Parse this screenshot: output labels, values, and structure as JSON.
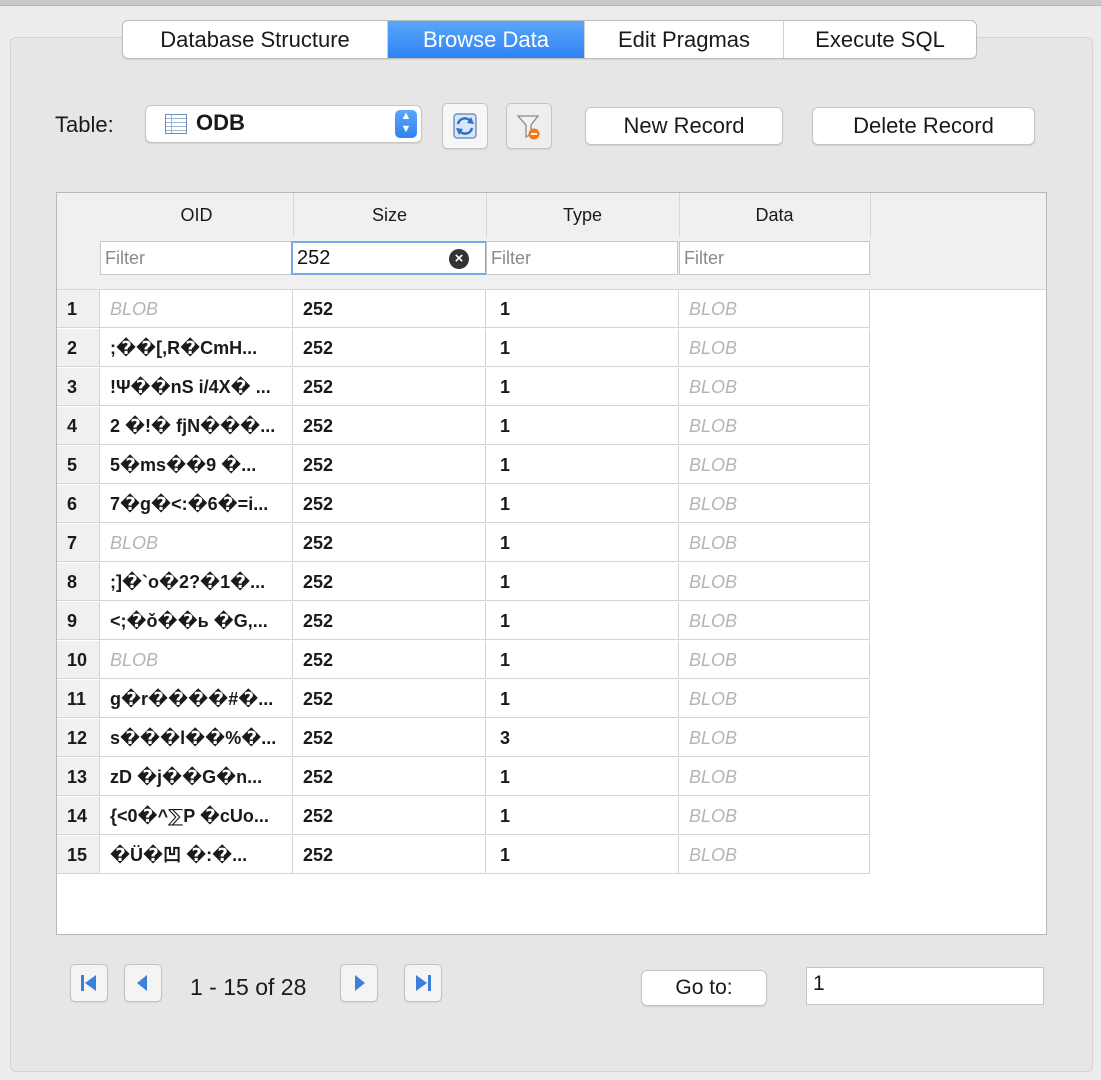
{
  "tabs": [
    {
      "label": "Database Structure",
      "active": false
    },
    {
      "label": "Browse Data",
      "active": true
    },
    {
      "label": "Edit Pragmas",
      "active": false
    },
    {
      "label": "Execute SQL",
      "active": false
    }
  ],
  "toolbar": {
    "table_label": "Table:",
    "table_selected": "ODB",
    "new_record": "New Record",
    "delete_record": "Delete Record"
  },
  "grid": {
    "columns": [
      "OID",
      "Size",
      "Type",
      "Data"
    ],
    "filters": {
      "placeholder": "Filter",
      "size_value": "252"
    },
    "rows": [
      {
        "n": "1",
        "oid": "BLOB",
        "size": "252",
        "type": "1",
        "data": "BLOB"
      },
      {
        "n": "2",
        "oid": ";��[,R�CmH...",
        "size": "252",
        "type": "1",
        "data": "BLOB"
      },
      {
        "n": "3",
        "oid": "!Ψ��nS i/4X� ...",
        "size": "252",
        "type": "1",
        "data": "BLOB"
      },
      {
        "n": "4",
        "oid": "2 �!� fjN���...",
        "size": "252",
        "type": "1",
        "data": "BLOB"
      },
      {
        "n": "5",
        "oid": "5�ms��9 �...",
        "size": "252",
        "type": "1",
        "data": "BLOB"
      },
      {
        "n": "6",
        "oid": "7�g�<:�6�=i...",
        "size": "252",
        "type": "1",
        "data": "BLOB"
      },
      {
        "n": "7",
        "oid": "BLOB",
        "size": "252",
        "type": "1",
        "data": "BLOB"
      },
      {
        "n": "8",
        "oid": ";]�`o�2?�1�...",
        "size": "252",
        "type": "1",
        "data": "BLOB"
      },
      {
        "n": "9",
        "oid": "<;�ǒ��ь �G,...",
        "size": "252",
        "type": "1",
        "data": "BLOB"
      },
      {
        "n": "10",
        "oid": "BLOB",
        "size": "252",
        "type": "1",
        "data": "BLOB"
      },
      {
        "n": "11",
        "oid": "g�r����#�...",
        "size": "252",
        "type": "1",
        "data": "BLOB"
      },
      {
        "n": "12",
        "oid": "s���l��%�...",
        "size": "252",
        "type": "3",
        "data": "BLOB"
      },
      {
        "n": "13",
        "oid": "zD �j��G�n...",
        "size": "252",
        "type": "1",
        "data": "BLOB"
      },
      {
        "n": "14",
        "oid": "{<0�^⅀P �cUo...",
        "size": "252",
        "type": "1",
        "data": "BLOB"
      },
      {
        "n": "15",
        "oid": "�Ü�凹 �:�...",
        "size": "252",
        "type": "1",
        "data": "BLOB"
      }
    ]
  },
  "pagination": {
    "range_text": "1 - 15 of 28",
    "goto_label": "Go to:",
    "goto_value": "1"
  },
  "colors": {
    "accent": "#2f84f2",
    "blob_text": "#b4b4b4"
  },
  "icons": [
    "table-icon",
    "refresh-icon",
    "clear-filter-icon",
    "first-page-icon",
    "prev-page-icon",
    "next-page-icon",
    "last-page-icon",
    "clear-icon"
  ]
}
